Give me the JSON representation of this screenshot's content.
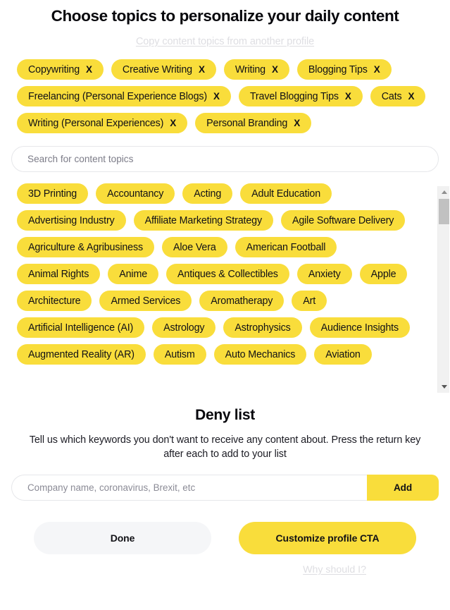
{
  "header": {
    "title": "Choose topics to personalize your daily content",
    "copy_link": "Copy content topics from another profile"
  },
  "selected_topics": [
    {
      "label": "Copywriting",
      "remove_icon": "X"
    },
    {
      "label": "Creative Writing",
      "remove_icon": "X"
    },
    {
      "label": "Writing",
      "remove_icon": "X"
    },
    {
      "label": "Blogging Tips",
      "remove_icon": "X"
    },
    {
      "label": "Freelancing (Personal Experience Blogs)",
      "remove_icon": "X"
    },
    {
      "label": "Travel Blogging Tips",
      "remove_icon": "X"
    },
    {
      "label": "Cats",
      "remove_icon": "X"
    },
    {
      "label": "Writing (Personal Experiences)",
      "remove_icon": "X"
    },
    {
      "label": "Personal Branding",
      "remove_icon": "X"
    }
  ],
  "search": {
    "placeholder": "Search for content topics",
    "value": ""
  },
  "available_topics": [
    "3D Printing",
    "Accountancy",
    "Acting",
    "Adult Education",
    "Advertising Industry",
    "Affiliate Marketing Strategy",
    "Agile Software Delivery",
    "Agriculture & Agribusiness",
    "Aloe Vera",
    "American Football",
    "Animal Rights",
    "Anime",
    "Antiques & Collectibles",
    "Anxiety",
    "Apple",
    "Architecture",
    "Armed Services",
    "Aromatherapy",
    "Art",
    "Artificial Intelligence (AI)",
    "Astrology",
    "Astrophysics",
    "Audience Insights",
    "Augmented Reality (AR)",
    "Autism",
    "Auto Mechanics",
    "Aviation"
  ],
  "scrollbar": {
    "up_arrow_icon": "triangle-up-icon",
    "down_arrow_icon": "triangle-down-icon"
  },
  "deny_list": {
    "title": "Deny list",
    "description": "Tell us which keywords you don't want to receive any content about. Press the return key after each to add to your list",
    "input_placeholder": "Company name, coronavirus, Brexit, etc",
    "input_value": "",
    "add_label": "Add"
  },
  "footer": {
    "done_label": "Done",
    "cta_label": "Customize profile CTA",
    "why_link": "Why should I?"
  },
  "colors": {
    "accent_yellow": "#f9dd3b",
    "text_dark": "#111116",
    "muted_link": "#dedee2",
    "button_grey": "#f5f6f8"
  }
}
